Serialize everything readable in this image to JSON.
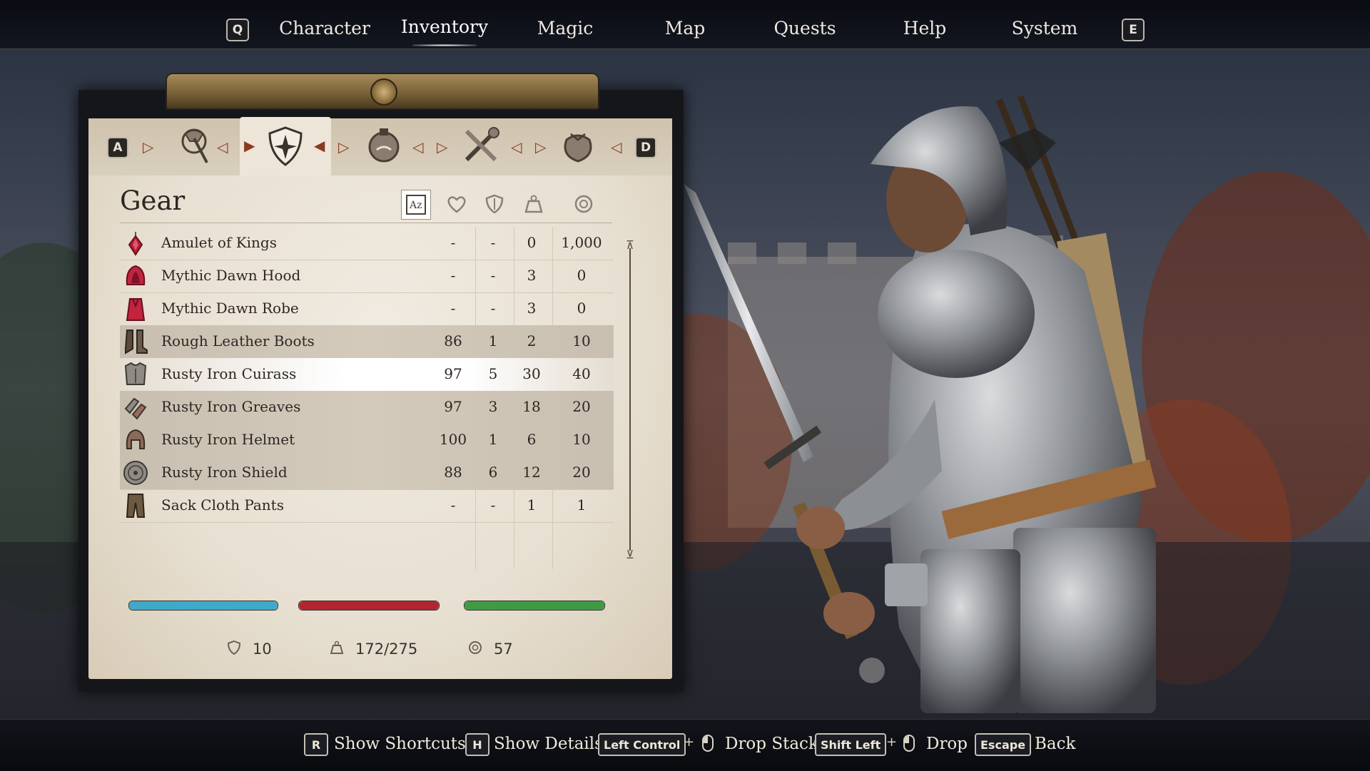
{
  "top_nav": {
    "left_key": "Q",
    "right_key": "E",
    "tabs": [
      {
        "label": "Character"
      },
      {
        "label": "Inventory",
        "active": true
      },
      {
        "label": "Magic"
      },
      {
        "label": "Map"
      },
      {
        "label": "Quests"
      },
      {
        "label": "Help"
      },
      {
        "label": "System"
      }
    ]
  },
  "category_tabs": {
    "left_key": "A",
    "right_key": "D",
    "items": [
      {
        "icon": "axe-weapon-icon"
      },
      {
        "icon": "armor-shield-icon",
        "active": true
      },
      {
        "icon": "potion-icon"
      },
      {
        "icon": "tools-misc-icon"
      },
      {
        "icon": "coin-pouch-icon"
      }
    ]
  },
  "inventory": {
    "title": "Gear",
    "sort_icons": [
      "sort-az-icon",
      "health-heart-icon",
      "armor-rating-icon",
      "weight-icon",
      "value-coin-icon"
    ],
    "items": [
      {
        "name": "Amulet of Kings",
        "c1": "-",
        "c2": "-",
        "c3": "0",
        "c4": "1,000",
        "icon": "amulet-icon",
        "equipped": false
      },
      {
        "name": "Mythic Dawn Hood",
        "c1": "-",
        "c2": "-",
        "c3": "3",
        "c4": "0",
        "icon": "hood-icon",
        "equipped": false
      },
      {
        "name": "Mythic Dawn Robe",
        "c1": "-",
        "c2": "-",
        "c3": "3",
        "c4": "0",
        "icon": "robe-icon",
        "equipped": false
      },
      {
        "name": "Rough Leather Boots",
        "c1": "86",
        "c2": "1",
        "c3": "2",
        "c4": "10",
        "icon": "boots-icon",
        "equipped": true
      },
      {
        "name": "Rusty Iron Cuirass",
        "c1": "97",
        "c2": "5",
        "c3": "30",
        "c4": "40",
        "icon": "cuirass-icon",
        "equipped": true,
        "selected": true
      },
      {
        "name": "Rusty Iron Greaves",
        "c1": "97",
        "c2": "3",
        "c3": "18",
        "c4": "20",
        "icon": "greaves-icon",
        "equipped": true
      },
      {
        "name": "Rusty Iron Helmet",
        "c1": "100",
        "c2": "1",
        "c3": "6",
        "c4": "10",
        "icon": "helmet-icon",
        "equipped": true
      },
      {
        "name": "Rusty Iron Shield",
        "c1": "88",
        "c2": "6",
        "c3": "12",
        "c4": "20",
        "icon": "shield-icon",
        "equipped": true
      },
      {
        "name": "Sack Cloth Pants",
        "c1": "-",
        "c2": "-",
        "c3": "1",
        "c4": "1",
        "icon": "pants-icon",
        "equipped": false
      }
    ]
  },
  "stat_bars": [
    {
      "name": "magicka",
      "color": "#3fa9c9",
      "fill": 1.0
    },
    {
      "name": "health",
      "color": "#b3242f",
      "fill": 1.0
    },
    {
      "name": "fatigue",
      "color": "#3f9a44",
      "fill": 1.0
    }
  ],
  "footer_stats": {
    "armor": "10",
    "weight": "172/275",
    "gold": "57"
  },
  "prompts": [
    {
      "keys": [
        "R"
      ],
      "label": "Show Shortcuts"
    },
    {
      "keys": [
        "H"
      ],
      "label": "Show Details"
    },
    {
      "keys": [
        "Left Control"
      ],
      "mouse": true,
      "label": "Drop Stack"
    },
    {
      "keys": [
        "Shift Left"
      ],
      "mouse": true,
      "label": "Drop"
    },
    {
      "keys": [
        "Escape"
      ],
      "label": "Back"
    }
  ],
  "plus_sign": "+"
}
